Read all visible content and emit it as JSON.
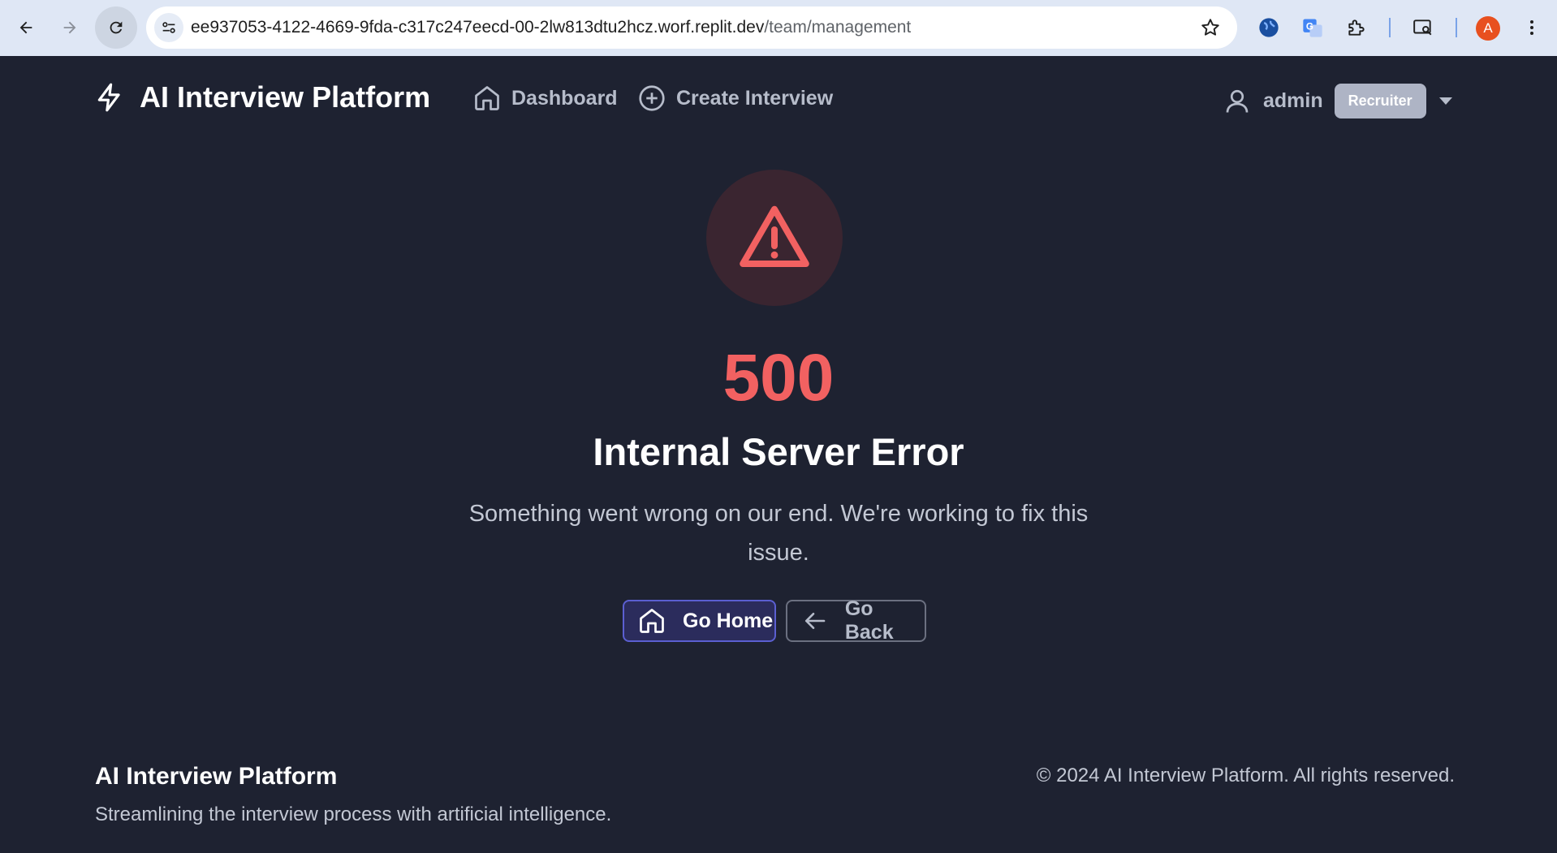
{
  "browser": {
    "url_host": "ee937053-4122-4669-9fda-c317c247eecd-00-2lw813dtu2hcz.worf.replit.dev",
    "url_path": "/team/management",
    "profile_initial": "A"
  },
  "header": {
    "brand_title": "AI Interview Platform",
    "nav": [
      {
        "label": "Dashboard",
        "icon": "home-icon"
      },
      {
        "label": "Create Interview",
        "icon": "plus-circle-icon"
      }
    ],
    "user_name": "admin",
    "role_badge": "Recruiter"
  },
  "error": {
    "code": "500",
    "title": "Internal Server Error",
    "message": "Something went wrong on our end. We're working to fix this issue.",
    "home_button": "Go Home",
    "back_button": "Go Back"
  },
  "footer": {
    "title": "AI Interview Platform",
    "tagline": "Streamlining the interview process with artificial intelligence.",
    "copyright": "© 2024 AI Interview Platform. All rights reserved."
  },
  "colors": {
    "background": "#1e2231",
    "error_red": "#f26161",
    "primary": "#5b5fd1"
  }
}
